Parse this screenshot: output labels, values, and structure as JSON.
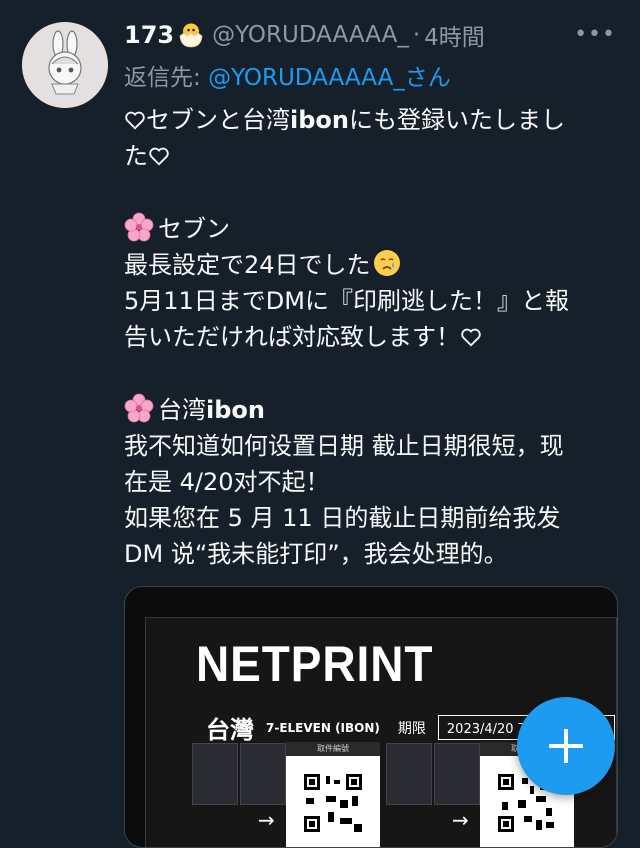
{
  "tweet": {
    "display_name": "173",
    "handle": "@YORUDAAAAA_",
    "separator": "·",
    "time": "4時間",
    "more_icon": "more-horizontal-icon",
    "reply_label": "返信先: ",
    "reply_handle": "@YORUDAAAAA_さん",
    "lines": {
      "l1": "セブンと台湾",
      "l1b": "ibon",
      "l1c": "にも登録いたしまし",
      "l2": "た",
      "l3": "セブン",
      "l4": "最長設定で24日でした",
      "l5": "5月11日までDMに『印刷逃した！』と報",
      "l6": "告いただければ対応致します！",
      "l7a": "台湾",
      "l7b": "ibon",
      "l8": "我不知道如何设置日期 截止日期很短，现",
      "l9": "在是 4/20对不起！",
      "l10": "如果您在 5 月 11 日的截止日期前给我发",
      "l11": "DM 说“我未能打印”，我会处理的。"
    }
  },
  "media": {
    "title": "NETPRINT",
    "region": "台灣",
    "store": "7-ELEVEN (IBON)",
    "deadline_label": "期限",
    "deadline": "2023/4/20 下午 04:34:59",
    "card_label": "取件編號"
  },
  "fab": {
    "icon": "plus-icon"
  },
  "colors": {
    "background": "#15202b",
    "accent": "#1d9bf0",
    "muted": "#8b98a5"
  }
}
